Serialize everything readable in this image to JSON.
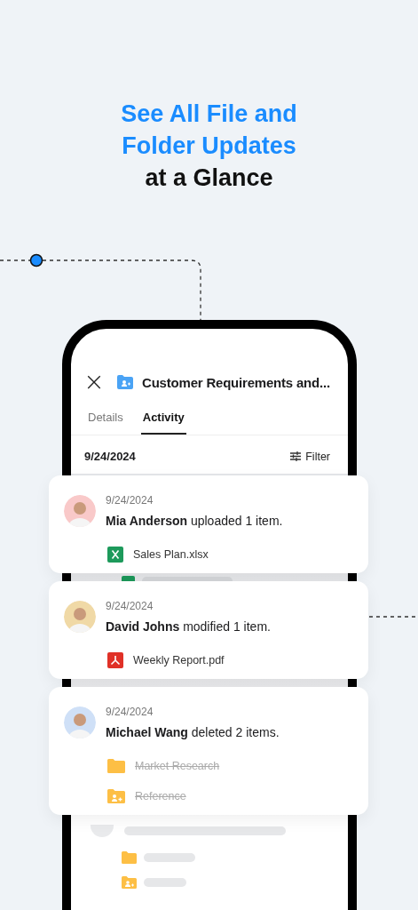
{
  "headline": [
    {
      "text": "See All File and",
      "accent": true
    },
    {
      "text": "Folder Updates",
      "accent": true
    },
    {
      "text": "at a Glance",
      "accent": false
    }
  ],
  "panel": {
    "close": "×",
    "title": "Customer Requirements and...",
    "date": "9/24/2024",
    "filter": "Filter"
  },
  "tabs": [
    {
      "label": "Details",
      "selected": false
    },
    {
      "label": "Activity",
      "selected": true
    }
  ],
  "activities": [
    {
      "date": "9/24/2024",
      "message": "**Mia Anderson** uploaded 1 item.",
      "color": "#f9c9c9",
      "files": [
        {
          "kind": "excel",
          "name": "Sales Plan.xlsx",
          "deleted": false
        }
      ]
    },
    {
      "date": "9/24/2024",
      "message": "**David Johns** modified 1 item.",
      "color": "#f0d9a6",
      "files": [
        {
          "kind": "pdf",
          "name": "Weekly Report.pdf",
          "deleted": false
        }
      ]
    },
    {
      "date": "9/24/2024",
      "message": "**Michael Wang** deleted 2 items.",
      "color": "#cfe0f7",
      "files": [
        {
          "kind": "folder",
          "name": "Market Research",
          "deleted": true
        },
        {
          "kind": "shared",
          "name": "Reference",
          "deleted": true
        }
      ]
    }
  ]
}
